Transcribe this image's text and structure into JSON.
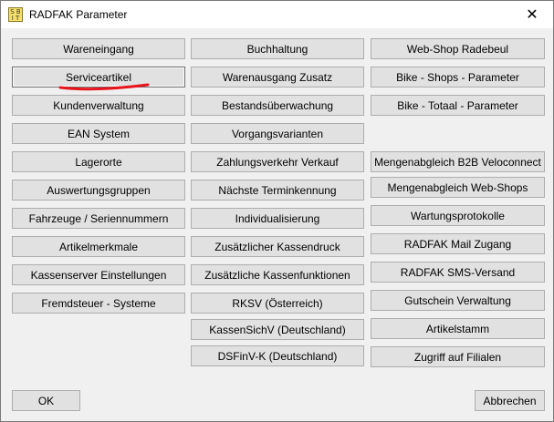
{
  "window": {
    "title": "RADFAK Parameter",
    "icon_name": "radfak-app-icon",
    "close_symbol": "✕"
  },
  "column1": [
    "Wareneingang",
    "Serviceartikel",
    "Kundenverwaltung",
    "EAN System",
    "Lagerorte",
    "Auswertungsgruppen",
    "Fahrzeuge / Seriennummern",
    "Artikelmerkmale",
    "Kassenserver Einstellungen",
    "Fremdsteuer - Systeme"
  ],
  "column2": [
    "Buchhaltung",
    "Warenausgang Zusatz",
    "Bestandsüberwachung",
    "Vorgangsvarianten",
    "Zahlungsverkehr Verkauf",
    "Nächste Terminkennung",
    "Individualisierung",
    "Zusätzlicher Kassendruck",
    "Zusätzliche Kassenfunktionen",
    "RKSV (Österreich)",
    "KassenSichV (Deutschland)",
    "DSFinV-K (Deutschland)"
  ],
  "column3_top": [
    "Web-Shop Radebeul",
    "Bike - Shops - Parameter",
    "Bike - Totaal - Parameter"
  ],
  "column3_bottom": [
    "Mengenabgleich B2B Veloconnect",
    "Mengenabgleich Web-Shops",
    "Wartungsprotokolle",
    "RADFAK Mail Zugang",
    "RADFAK SMS-Versand",
    "Gutschein Verwaltung",
    "Artikelstamm",
    "Zugriff auf Filialen"
  ],
  "footer": {
    "ok_label": "OK",
    "cancel_label": "Abbrechen"
  },
  "colors": {
    "annotation_red": "#e8141c"
  }
}
